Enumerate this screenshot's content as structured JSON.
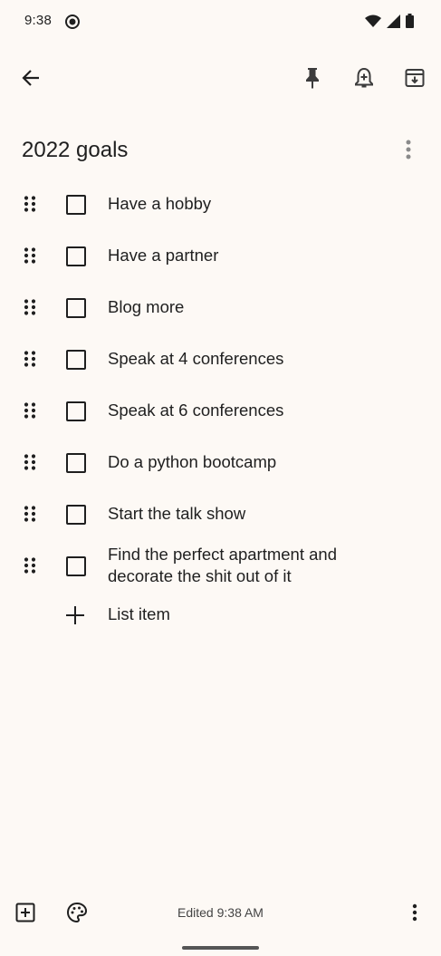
{
  "status": {
    "time": "9:38"
  },
  "note": {
    "title": "2022 goals",
    "items": [
      {
        "text": "Have a hobby",
        "checked": false
      },
      {
        "text": "Have a partner",
        "checked": false
      },
      {
        "text": "Blog more",
        "checked": false
      },
      {
        "text": "Speak at 4 conferences",
        "checked": false
      },
      {
        "text": "Speak at 6 conferences",
        "checked": false
      },
      {
        "text": "Do a python bootcamp",
        "checked": false
      },
      {
        "text": "Start the talk show",
        "checked": false
      },
      {
        "text": "Find the perfect apartment and decorate the shit out of it",
        "checked": false
      }
    ],
    "add_item_label": "List item"
  },
  "bottom_bar": {
    "edited": "Edited 9:38 AM"
  },
  "icons": {
    "back": "arrow-back-icon",
    "pin": "pin-icon",
    "reminder": "bell-plus-icon",
    "archive": "archive-icon",
    "more": "more-vert-icon",
    "add_box": "add-box-icon",
    "palette": "palette-icon"
  }
}
